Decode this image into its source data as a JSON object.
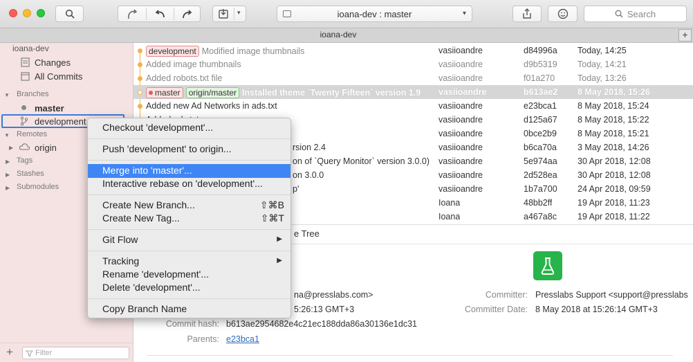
{
  "toolbar": {
    "branch_select_label": "ioana-dev :  master",
    "search_placeholder": "Search"
  },
  "tab": {
    "title": "ioana-dev",
    "add_label": "+"
  },
  "sidebar": {
    "repo_name": "ioana-dev",
    "changes": "Changes",
    "all_commits": "All Commits",
    "branches_header": "Branches",
    "branch_master": "master",
    "branch_development": "development",
    "remotes_header": "Remotes",
    "remote_origin": "origin",
    "tags_header": "Tags",
    "stashes_header": "Stashes",
    "submodules_header": "Submodules",
    "filter_placeholder": "Filter",
    "add_label": "+"
  },
  "commits": [
    {
      "badge_local": "development",
      "message": "Modified image thumbnails",
      "author": "vasiioandre",
      "hash": "d84996a",
      "date": "Today, 14:25"
    },
    {
      "message": "Added image thumbnails",
      "author": "vasiioandre",
      "hash": "d9b5319",
      "date": "Today, 14:21"
    },
    {
      "message": "Added robots.txt file",
      "author": "vasiioandre",
      "hash": "f01a270",
      "date": "Today, 13:26"
    },
    {
      "badge_local": "master",
      "badge_remote": "origin/master",
      "message": "Installed theme `Twenty Fifteen` version 1.9",
      "author": "vasiioandre",
      "hash": "b613ae2",
      "date": "8 May 2018, 15:26"
    },
    {
      "message": "Added new Ad Networks in ads.txt",
      "author": "vasiioandre",
      "hash": "e23bca1",
      "date": "8 May 2018, 15:24"
    },
    {
      "message": "Added ads.txt",
      "author": "vasiioandre",
      "hash": "d125a67",
      "date": "8 May 2018, 15:22"
    },
    {
      "message": "",
      "author": "vasiioandre",
      "hash": "0bce2b9",
      "date": "8 May 2018, 15:21"
    },
    {
      "message": "rsion 2.4",
      "author": "vasiioandre",
      "hash": "b6ca70a",
      "date": "3 May 2018, 14:26"
    },
    {
      "message": "on of `Query Monitor` version 3.0.0)",
      "author": "vasiioandre",
      "hash": "5e974aa",
      "date": "30 Apr 2018, 12:08"
    },
    {
      "message": "on 3.0.0",
      "author": "vasiioandre",
      "hash": "2d528ea",
      "date": "30 Apr 2018, 12:08"
    },
    {
      "message": "p'",
      "author": "vasiioandre",
      "hash": "1b7a700",
      "date": "24 Apr 2018, 09:59"
    },
    {
      "message": "",
      "author": "Ioana",
      "hash": "48bb2ff",
      "date": "19 Apr 2018, 11:23"
    },
    {
      "message": "",
      "author": "Ioana",
      "hash": "a467a8c",
      "date": "19 Apr 2018, 11:22"
    }
  ],
  "detail": {
    "tree_label": "e Tree",
    "author_partial": "na@presslabs.com>",
    "date_partial": "5:26:13 GMT+3",
    "committer_label": "Committer:",
    "committer_value": "Presslabs Support <support@presslabs",
    "committer_date_label": "Committer Date:",
    "committer_date_value": "8 May 2018 at 15:26:14 GMT+3",
    "commit_hash_label": "Commit hash:",
    "commit_hash_value": "b613ae2954682e4c21ec188dda86a30136e1dc31",
    "parents_label": "Parents:",
    "parents_value": "e23bca1"
  },
  "context_menu": {
    "checkout": "Checkout 'development'...",
    "push": "Push 'development' to origin...",
    "merge": "Merge into 'master'...",
    "rebase": "Interactive rebase on 'development'...",
    "new_branch": "Create New Branch...",
    "new_branch_shortcut": "⇧⌘B",
    "new_tag": "Create New Tag...",
    "new_tag_shortcut": "⇧⌘T",
    "git_flow": "Git Flow",
    "tracking": "Tracking",
    "rename": "Rename 'development'...",
    "delete": "Delete 'development'...",
    "copy_name": "Copy Branch Name"
  },
  "colors": {
    "accent": "#3f86f5",
    "sidebar_bg": "#f5e3e3",
    "graph": "#f1b34e",
    "flask": "#27b44a"
  }
}
